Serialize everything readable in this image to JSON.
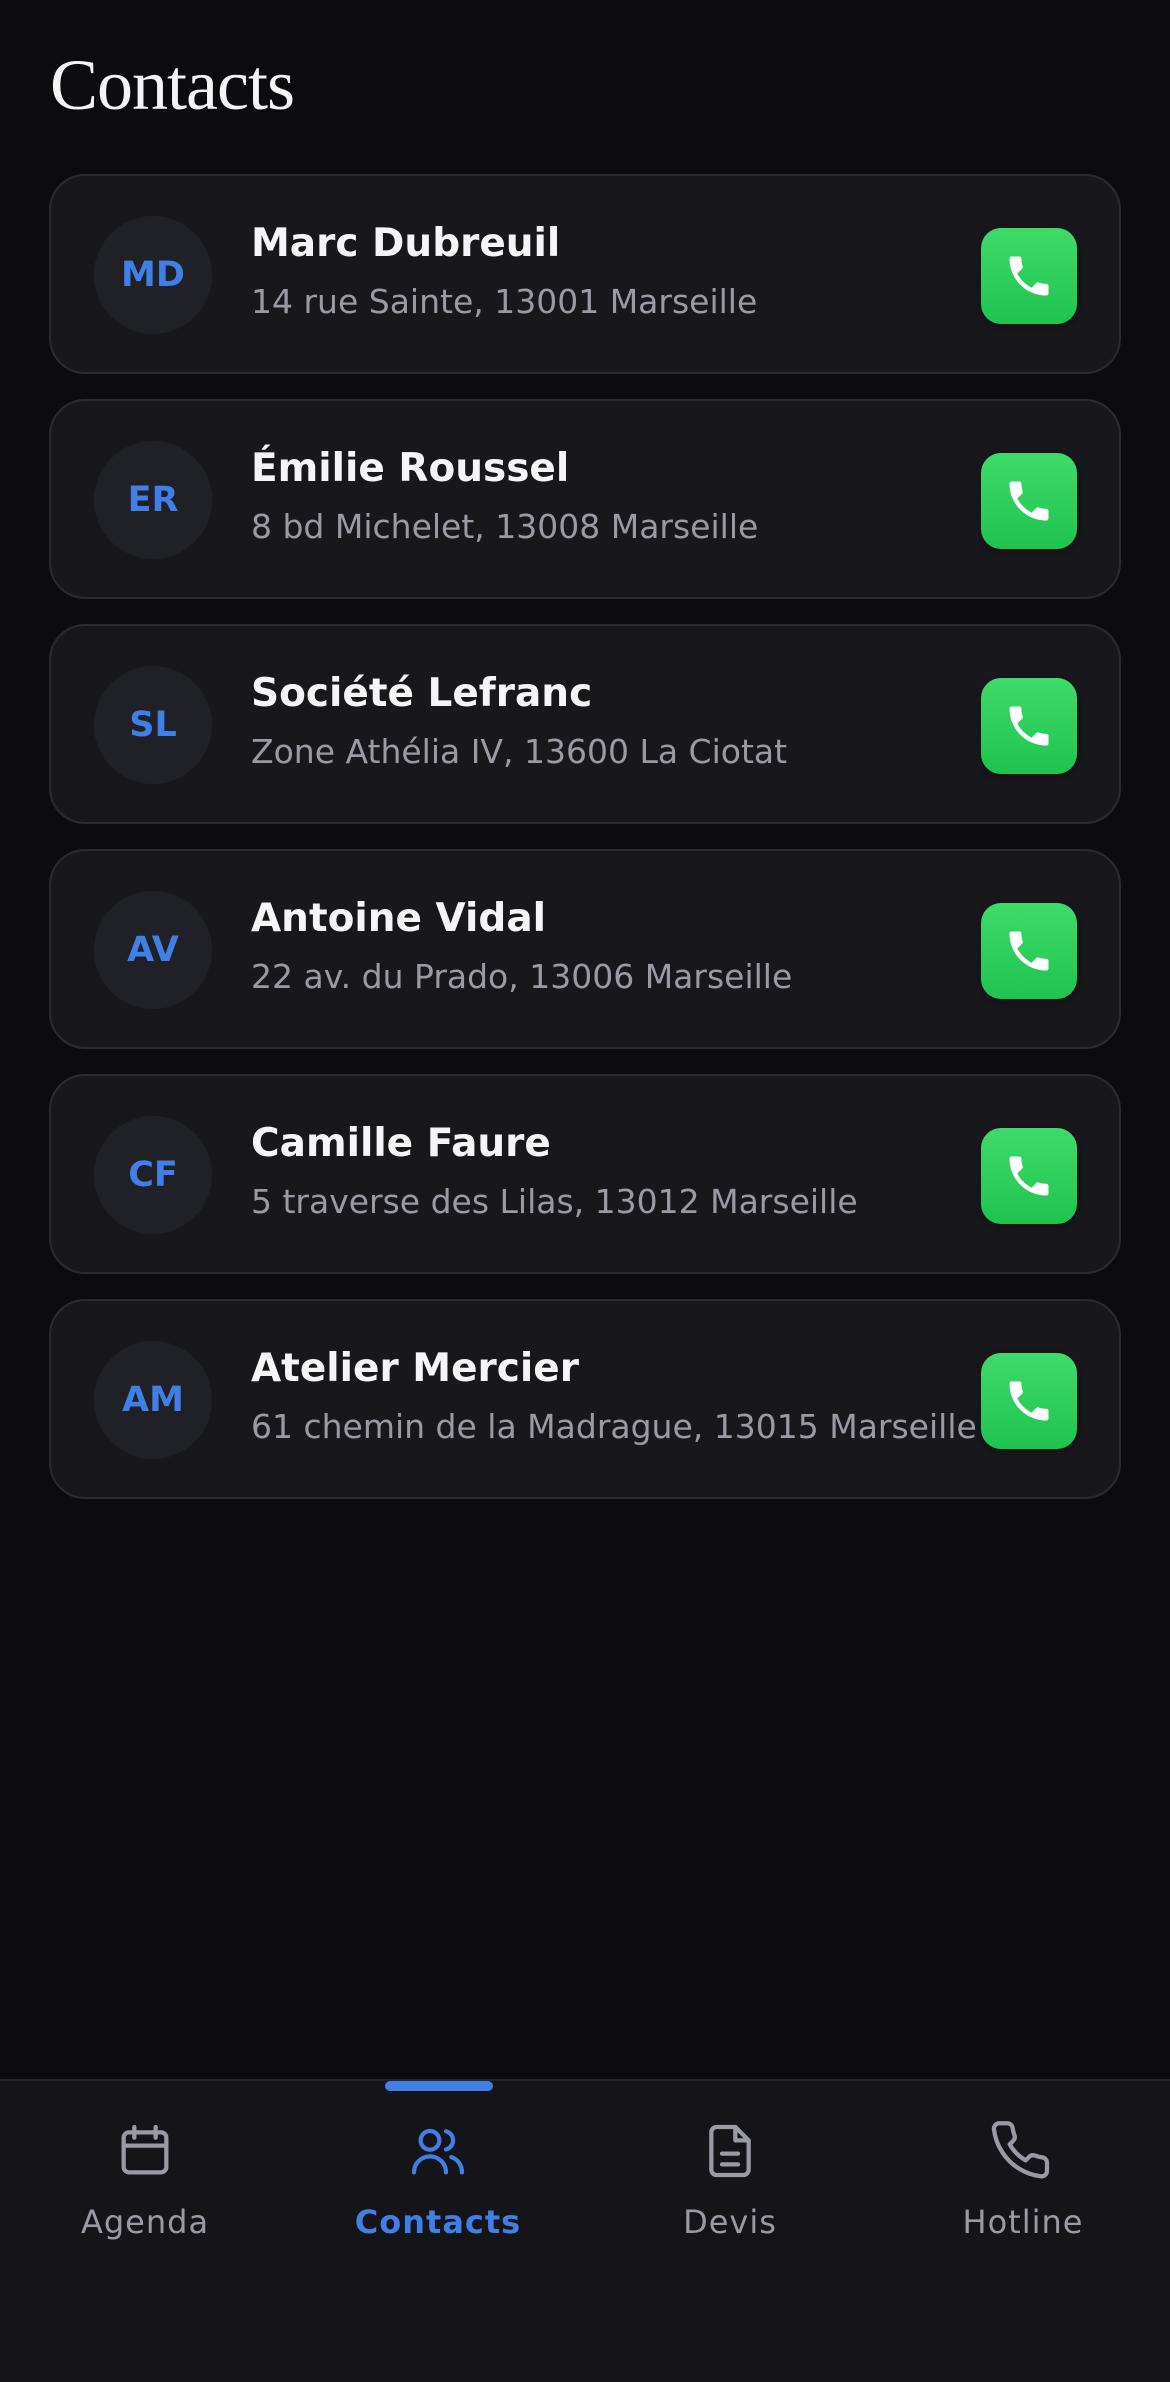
{
  "header": {
    "title": "Contacts"
  },
  "contacts": [
    {
      "initials": "MD",
      "name": "Marc Dubreuil",
      "address": "14 rue Sainte, 13001 Marseille"
    },
    {
      "initials": "ER",
      "name": "Émilie Roussel",
      "address": "8 bd Michelet, 13008 Marseille"
    },
    {
      "initials": "SL",
      "name": "Société Lefranc",
      "address": "Zone Athélia IV, 13600 La Ciotat"
    },
    {
      "initials": "AV",
      "name": "Antoine Vidal",
      "address": "22 av. du Prado, 13006 Marseille"
    },
    {
      "initials": "CF",
      "name": "Camille Faure",
      "address": "5 traverse des Lilas, 13012 Marseille"
    },
    {
      "initials": "AM",
      "name": "Atelier Mercier",
      "address": "61 chemin de la Madrague, 13015 Marseille"
    }
  ],
  "tabs": [
    {
      "label": "Agenda",
      "icon": "calendar-icon",
      "active": false
    },
    {
      "label": "Contacts",
      "icon": "users-icon",
      "active": true
    },
    {
      "label": "Devis",
      "icon": "document-icon",
      "active": false
    },
    {
      "label": "Hotline",
      "icon": "phone-icon",
      "active": false
    }
  ],
  "colors": {
    "background": "#0c0c0e",
    "card": "#18181c",
    "accent": "#3f7fe6",
    "call_green": "#28cc58",
    "muted_text": "#9a9aa5"
  }
}
